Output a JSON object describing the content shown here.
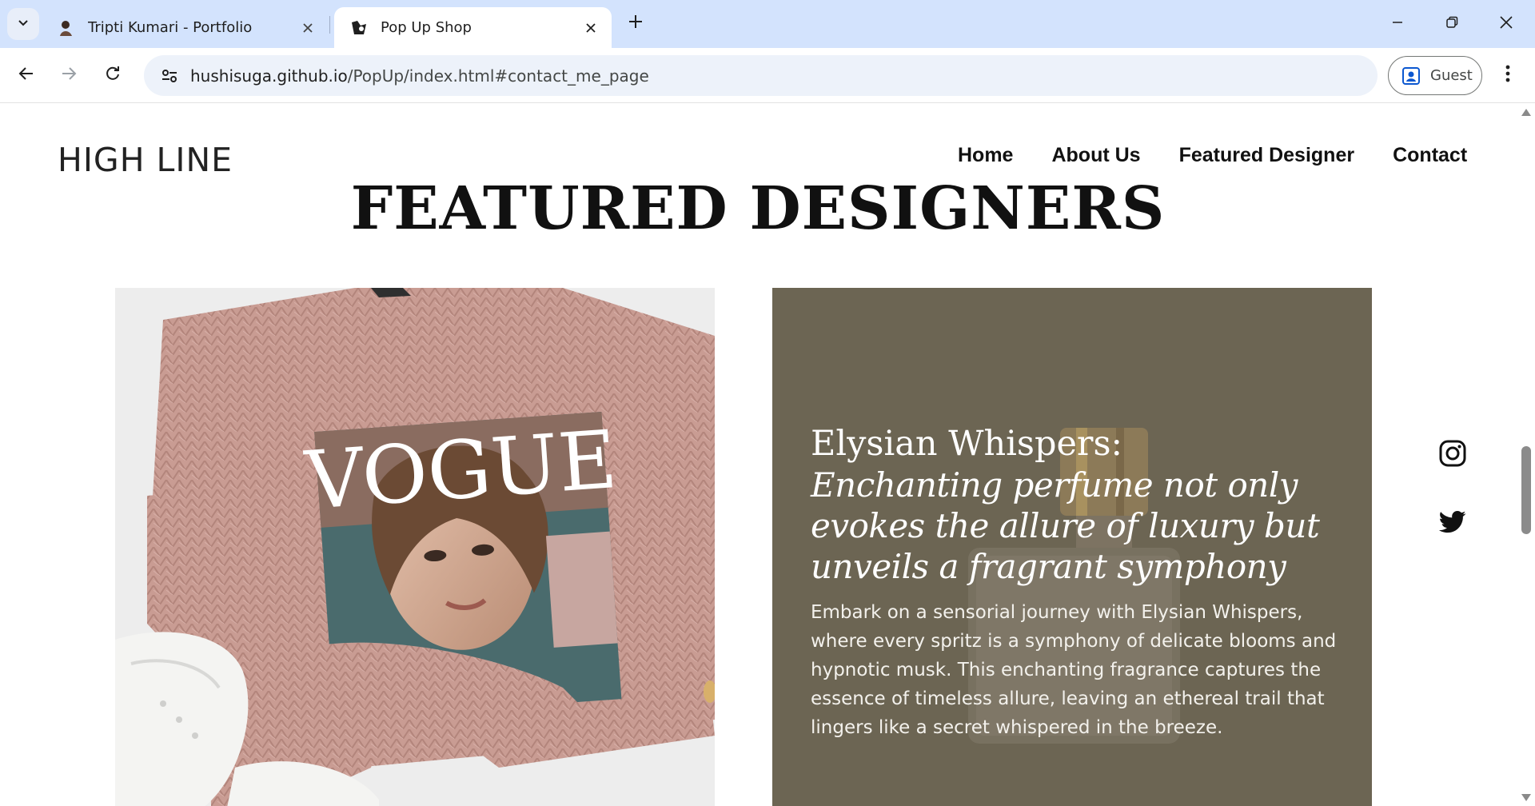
{
  "browser": {
    "tabs": [
      {
        "title": "Tripti Kumari - Portfolio",
        "active": false
      },
      {
        "title": "Pop Up Shop",
        "active": true
      }
    ],
    "url_host": "hushisuga.github.io",
    "url_path": "/PopUp/index.html#contact_me_page",
    "profile_label": "Guest"
  },
  "site": {
    "brand": "HIGH LINE",
    "nav": [
      "Home",
      "About Us",
      "Featured Designer",
      "Contact"
    ],
    "section_title": "FEATURED DESIGNERS",
    "magazine_title": "VOGUE",
    "feature": {
      "heading": "Elysian Whispers:",
      "subheading": "Enchanting perfume not only evokes the allure of luxury but unveils a fragrant symphony",
      "body": "Embark on a sensorial journey with Elysian Whispers, where every spritz is a symphony of delicate blooms and hypnotic musk. This enchanting fragrance captures the essence of timeless allure, leaving an ethereal trail that lingers like a secret whispered in the breeze."
    },
    "social_icons": [
      "instagram-icon",
      "twitter-icon"
    ]
  },
  "colors": {
    "tabstrip": "#d3e3fd",
    "perfume_overlay": "#6c6553",
    "sweater": "#c99c93"
  }
}
